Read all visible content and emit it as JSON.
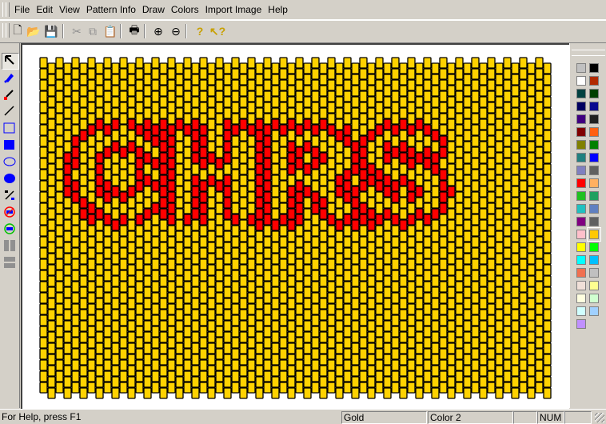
{
  "menu": [
    "File",
    "Edit",
    "View",
    "Pattern Info",
    "Draw",
    "Colors",
    "Import Image",
    "Help"
  ],
  "toolbar": [
    {
      "name": "new-file-icon",
      "glyph": "🗋"
    },
    {
      "name": "open-folder-icon",
      "glyph": "📂"
    },
    {
      "name": "save-icon",
      "glyph": "💾"
    },
    {
      "name": "cut-icon",
      "glyph": "✂"
    },
    {
      "name": "copy-icon",
      "glyph": "⧉"
    },
    {
      "name": "paste-icon",
      "glyph": "📋"
    },
    {
      "name": "print-icon",
      "glyph": "🖶"
    },
    {
      "name": "zoom-in-icon",
      "glyph": "⊕"
    },
    {
      "name": "zoom-out-icon",
      "glyph": "⊖"
    },
    {
      "name": "help-icon",
      "glyph": "?"
    },
    {
      "name": "context-help-icon",
      "glyph": "↖?"
    }
  ],
  "tools": [
    "select-arrow",
    "fill-bucket",
    "eyedropper",
    "line",
    "rectangle-outline",
    "rectangle-filled",
    "ellipse-outline",
    "ellipse-filled",
    "swap-colors",
    "replace-color",
    "replace-color-all",
    "split-vertical",
    "split-horizontal"
  ],
  "palette": {
    "colors": [
      "#c0c0c0",
      "#000000",
      "#ffffff",
      "#b22a00",
      "#004040",
      "#004000",
      "#000060",
      "#0a0a90",
      "#400080",
      "#202020",
      "#800000",
      "#ff6010",
      "#808000",
      "#008000",
      "#208080",
      "#0000ff",
      "#8080c0",
      "#606060",
      "#ff0000",
      "#ffb060",
      "#20c020",
      "#20a060",
      "#20c0c0",
      "#6080c0",
      "#800080",
      "#606060",
      "#ffc0cb",
      "#ffc800",
      "#ffff00",
      "#00ff00",
      "#00ffff",
      "#00c0ff",
      "#f07050",
      "#c0c0c0",
      "#f0e0d8",
      "#ffff90",
      "#ffffe0",
      "#d0ffd0",
      "#d0ffff",
      "#a0d0ff",
      "#c090ff"
    ],
    "selected_index": 27
  },
  "pattern": {
    "columns": 64,
    "rows": 30,
    "bead_color": "#ffd200",
    "accent_color": "#ff0000",
    "text": "CHRS"
  },
  "status": {
    "help": "For Help, press F1",
    "color_name": "Gold",
    "color_slot": "Color 2",
    "cap": "",
    "num": "NUM",
    "scrl": ""
  }
}
